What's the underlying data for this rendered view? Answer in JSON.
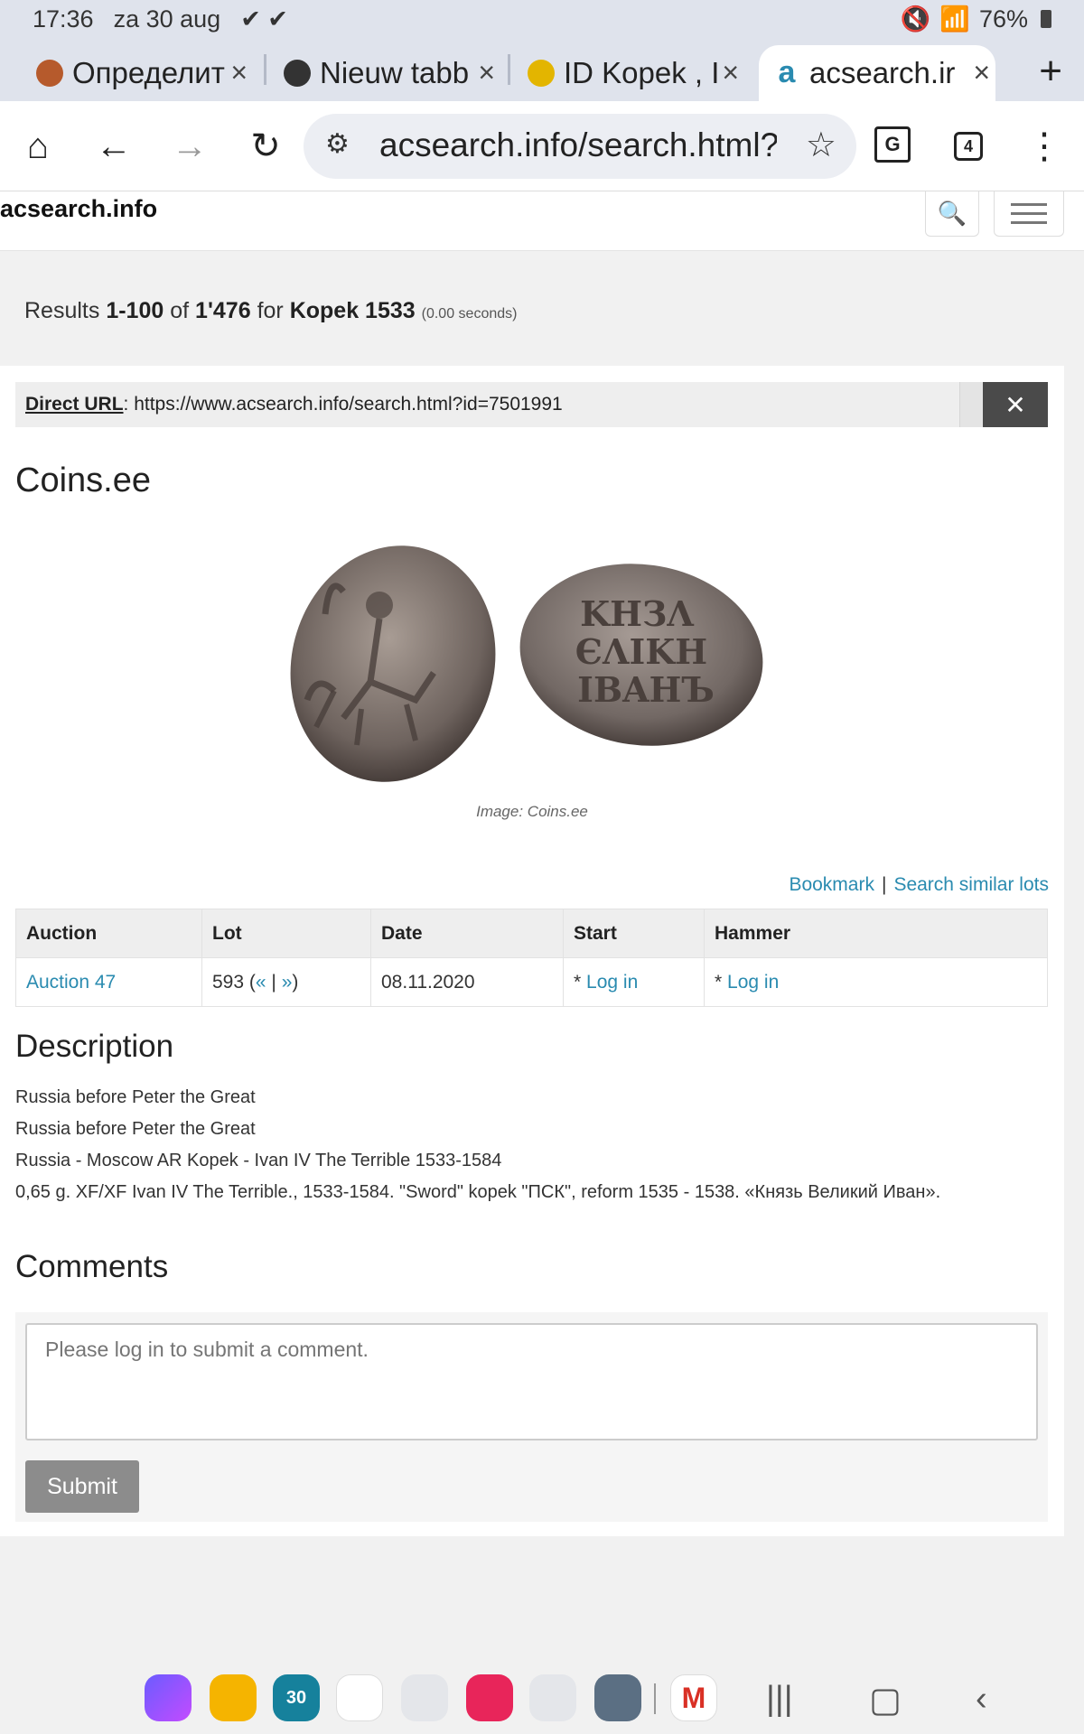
{
  "status_bar": {
    "time": "17:36",
    "date": "za 30 aug",
    "notif_icons": "✔ ✔",
    "battery": "76%"
  },
  "tabs": [
    {
      "title": "Определит",
      "favicon": "coin-favicon"
    },
    {
      "title": "Nieuw tabb",
      "favicon": "chrome-favicon"
    },
    {
      "title": "ID Kopek , I",
      "favicon": "id-favicon"
    },
    {
      "title": "acsearch.ir",
      "favicon": "acsearch-favicon",
      "active": true
    }
  ],
  "toolbar": {
    "url": "acsearch.info/search.html?t",
    "tab_count": "4",
    "translate_label": "G"
  },
  "site": {
    "logo": "acsearch.info"
  },
  "results": {
    "prefix": "Results",
    "range": "1-100",
    "of": "of",
    "total": "1'476",
    "for": "for",
    "query": "Kopek 1533",
    "time": "(0.00 seconds)"
  },
  "direct_url": {
    "label": "Direct URL",
    "value": ": https://www.acsearch.info/search.html?id=7501991"
  },
  "lot": {
    "auction_house": "Coins.ee",
    "image_caption": "Image: Coins.ee",
    "bookmark": "Bookmark",
    "search_similar": "Search similar lots",
    "table": {
      "headers": [
        "Auction",
        "Lot",
        "Date",
        "Start",
        "Hammer"
      ],
      "auction": "Auction 47",
      "lot_number": "593",
      "date": "08.11.2020",
      "start_prefix": "*",
      "start_link": "Log in",
      "hammer_prefix": "*",
      "hammer_link": "Log in"
    },
    "description_heading": "Description",
    "description": [
      "Russia before Peter the Great",
      "Russia before Peter the Great",
      "Russia - Moscow AR Kopek - Ivan IV The Terrible 1533-1584",
      "0,65 g. XF/XF Ivan IV The Terrible., 1533-1584. \"Sword\" kopek \"ПСК\", reform 1535 - 1538. «Князь Великий Иван»."
    ],
    "comments_heading": "Comments",
    "comment_placeholder": "Please log in to submit a comment.",
    "submit_label": "Submit"
  },
  "colors": {
    "link": "#2a8bb0",
    "chrome_bg": "#dfe3ec",
    "close_button": "#4a4a4a",
    "submit_button": "#8c8c8c"
  }
}
